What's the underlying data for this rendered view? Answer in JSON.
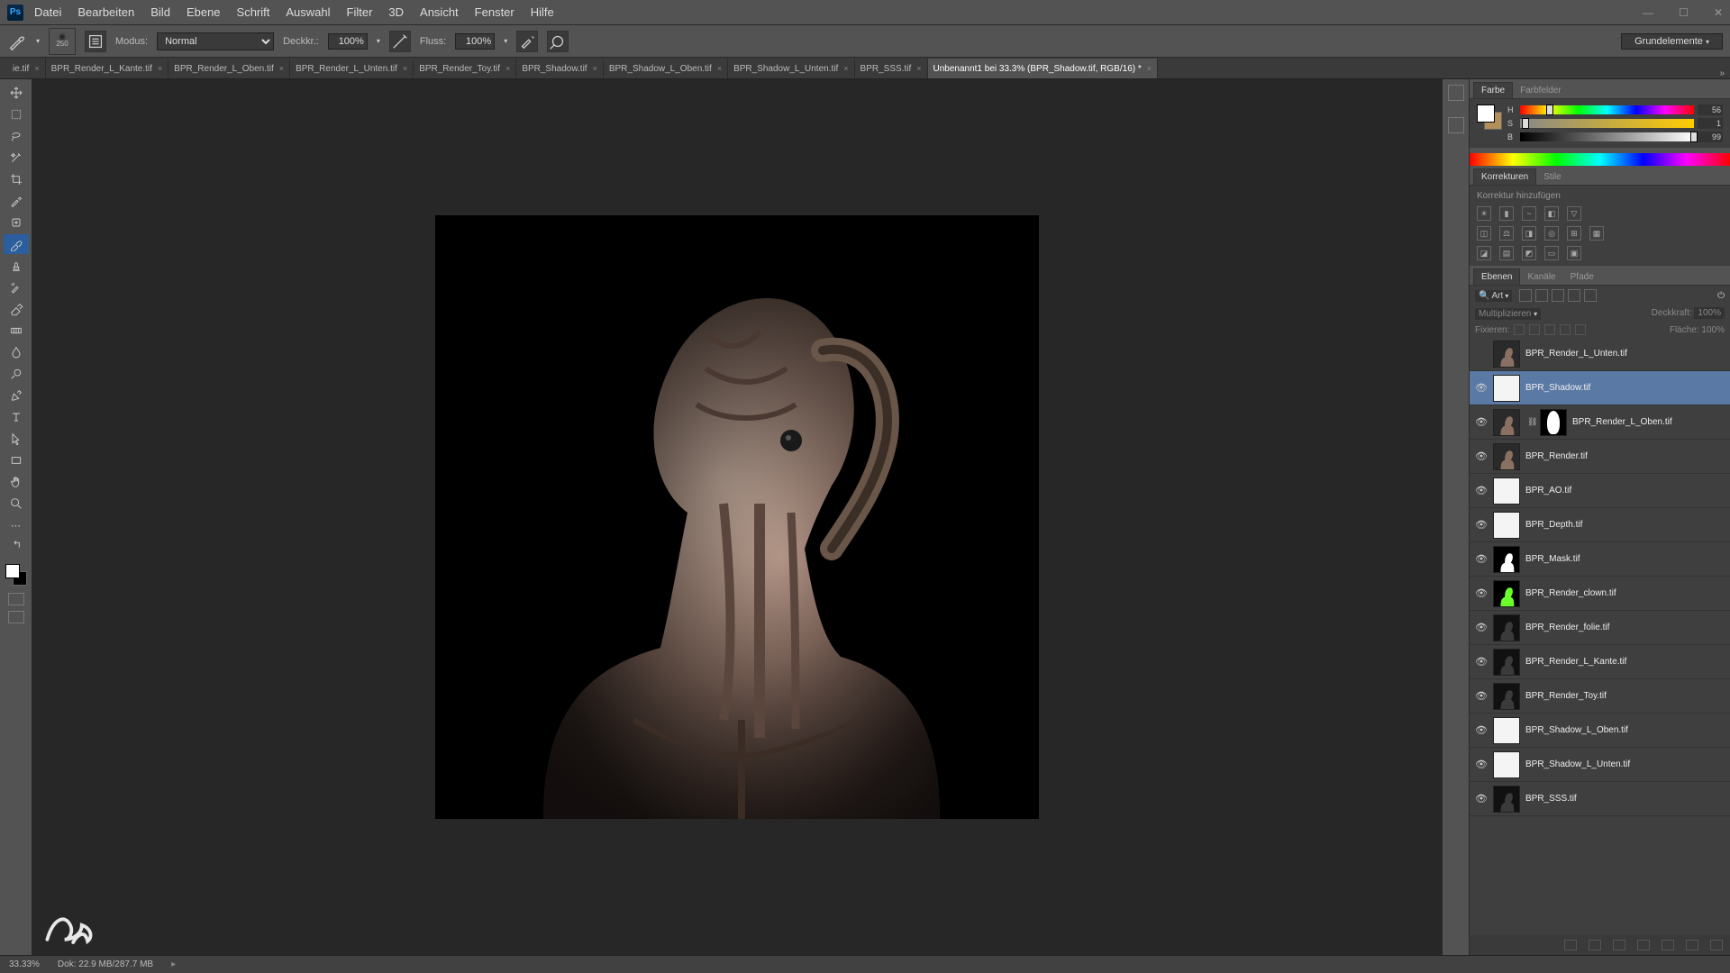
{
  "menu": [
    "Datei",
    "Bearbeiten",
    "Bild",
    "Ebene",
    "Schrift",
    "Auswahl",
    "Filter",
    "3D",
    "Ansicht",
    "Fenster",
    "Hilfe"
  ],
  "optbar": {
    "brush_size": "250",
    "modus_label": "Modus:",
    "modus_value": "Normal",
    "deckkr_label": "Deckkr.:",
    "deckkr_value": "100%",
    "fluss_label": "Fluss:",
    "fluss_value": "100%",
    "workspace": "Grundelemente"
  },
  "tabs": [
    {
      "label": "ie.tif",
      "active": false
    },
    {
      "label": "BPR_Render_L_Kante.tif",
      "active": false
    },
    {
      "label": "BPR_Render_L_Oben.tif",
      "active": false
    },
    {
      "label": "BPR_Render_L_Unten.tif",
      "active": false
    },
    {
      "label": "BPR_Render_Toy.tif",
      "active": false
    },
    {
      "label": "BPR_Shadow.tif",
      "active": false
    },
    {
      "label": "BPR_Shadow_L_Oben.tif",
      "active": false
    },
    {
      "label": "BPR_Shadow_L_Unten.tif",
      "active": false
    },
    {
      "label": "BPR_SSS.tif",
      "active": false
    },
    {
      "label": "Unbenannt1 bei 33.3% (BPR_Shadow.tif, RGB/16) *",
      "active": true
    }
  ],
  "color_panel": {
    "tab_farbe": "Farbe",
    "tab_farbfelder": "Farbfelder",
    "h": "56",
    "s": "1",
    "b": "99"
  },
  "adjustments": {
    "tab_korrekturen": "Korrekturen",
    "tab_stile": "Stile",
    "hint": "Korrektur hinzufügen"
  },
  "layers_panel": {
    "tab_ebenen": "Ebenen",
    "tab_kanaele": "Kanäle",
    "tab_pfade": "Pfade",
    "kind_label": "Art",
    "blend": "Multiplizieren",
    "deck_label": "Deckkraft:",
    "deck_value": "100%",
    "fix_label": "Fixieren:",
    "flaeche_label": "Fläche:",
    "flaeche_value": "100%"
  },
  "layers": [
    {
      "visible": false,
      "name": "BPR_Render_L_Unten.tif",
      "thumb": "creature",
      "active": false,
      "mask": false
    },
    {
      "visible": true,
      "name": "BPR_Shadow.tif",
      "thumb": "white",
      "active": true,
      "mask": false
    },
    {
      "visible": true,
      "name": "BPR_Render_L_Oben.tif",
      "thumb": "creature",
      "active": false,
      "mask": true
    },
    {
      "visible": true,
      "name": "BPR_Render.tif",
      "thumb": "creature",
      "active": false,
      "mask": false
    },
    {
      "visible": true,
      "name": "BPR_AO.tif",
      "thumb": "white",
      "active": false,
      "mask": false
    },
    {
      "visible": true,
      "name": "BPR_Depth.tif",
      "thumb": "white",
      "active": false,
      "mask": false
    },
    {
      "visible": true,
      "name": "BPR_Mask.tif",
      "thumb": "whitebust",
      "active": false,
      "mask": false
    },
    {
      "visible": true,
      "name": "BPR_Render_clown.tif",
      "thumb": "green",
      "active": false,
      "mask": false
    },
    {
      "visible": true,
      "name": "BPR_Render_folie.tif",
      "thumb": "dark",
      "active": false,
      "mask": false
    },
    {
      "visible": true,
      "name": "BPR_Render_L_Kante.tif",
      "thumb": "dark",
      "active": false,
      "mask": false
    },
    {
      "visible": true,
      "name": "BPR_Render_Toy.tif",
      "thumb": "dark",
      "active": false,
      "mask": false
    },
    {
      "visible": true,
      "name": "BPR_Shadow_L_Oben.tif",
      "thumb": "white",
      "active": false,
      "mask": false
    },
    {
      "visible": true,
      "name": "BPR_Shadow_L_Unten.tif",
      "thumb": "white",
      "active": false,
      "mask": false
    },
    {
      "visible": true,
      "name": "BPR_SSS.tif",
      "thumb": "dark",
      "active": false,
      "mask": false
    }
  ],
  "status": {
    "zoom": "33.33%",
    "doc": "Dok: 22.9 MB/287.7 MB"
  }
}
